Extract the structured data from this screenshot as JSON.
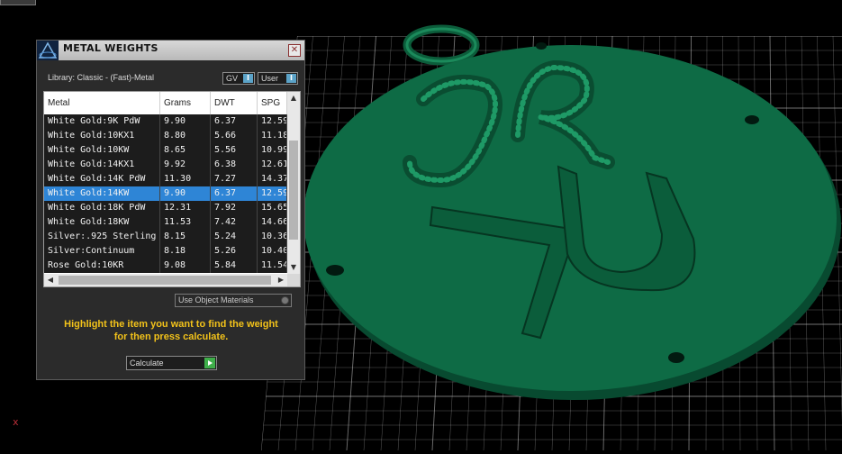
{
  "panel": {
    "title": "METAL WEIGHTS",
    "close_label": "✕",
    "library": "Library: Classic - (Fast)-Metal",
    "toggle_gv": "GV",
    "toggle_user": "User",
    "toggle_indicator": "I",
    "columns": [
      "Metal",
      "Grams",
      "DWT",
      "SPG"
    ],
    "rows": [
      [
        "White Gold:9K PdW",
        "9.90",
        "6.37",
        "12.59"
      ],
      [
        "White Gold:10KX1",
        "8.80",
        "5.66",
        "11.18"
      ],
      [
        "White Gold:10KW",
        "8.65",
        "5.56",
        "10.99"
      ],
      [
        "White Gold:14KX1",
        "9.92",
        "6.38",
        "12.61"
      ],
      [
        "White Gold:14K PdW",
        "11.30",
        "7.27",
        "14.37"
      ],
      [
        "White Gold:14KW",
        "9.90",
        "6.37",
        "12.59"
      ],
      [
        "White Gold:18K PdW",
        "12.31",
        "7.92",
        "15.65"
      ],
      [
        "White Gold:18KW",
        "11.53",
        "7.42",
        "14.66"
      ],
      [
        "Silver:.925 Sterling",
        "8.15",
        "5.24",
        "10.36"
      ],
      [
        "Silver:Continuum",
        "8.18",
        "5.26",
        "10.40"
      ],
      [
        "Rose Gold:10KR",
        "9.08",
        "5.84",
        "11.54"
      ]
    ],
    "selected_row": 5,
    "use_object_materials": "Use Object Materials",
    "instructions_line1": "Highlight the item you want to find the weight",
    "instructions_line2": "for then press calculate.",
    "calculate": "Calculate"
  },
  "viewport": {
    "axis_label": "x",
    "model_color": "#0e6b45",
    "grid_color": "#cfcfcf"
  },
  "colors": {
    "selection": "#2e85d6",
    "instruction_text": "#f2c21a"
  }
}
